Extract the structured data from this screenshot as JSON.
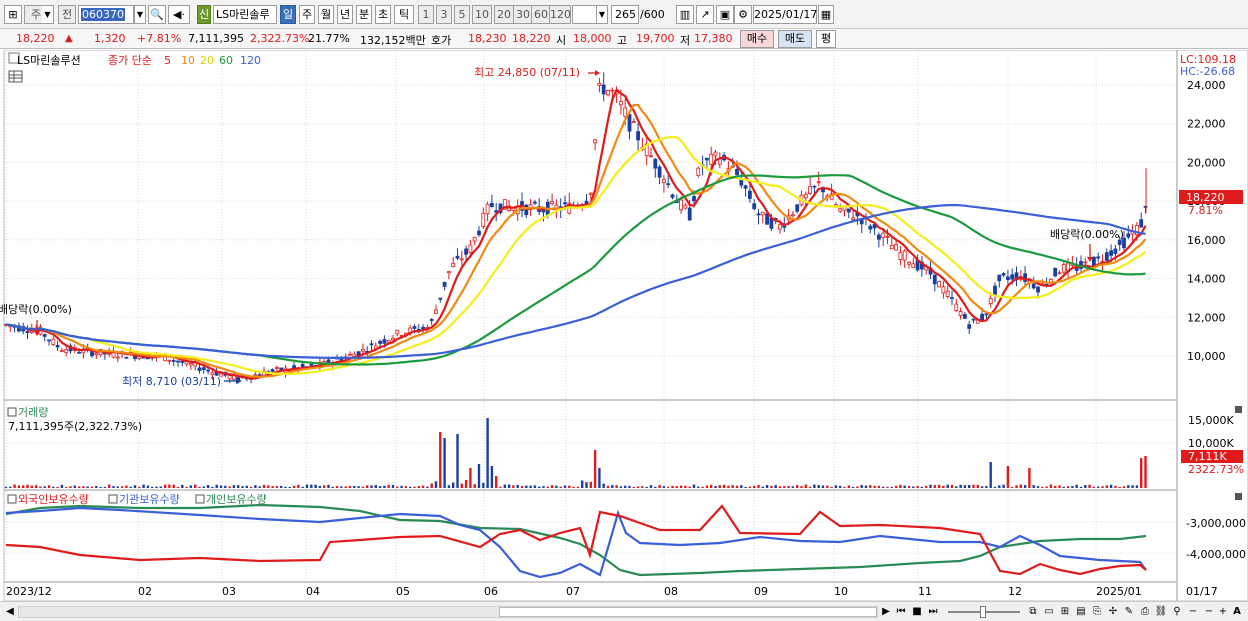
{
  "toolbar": {
    "period_buttons": [
      "주",
      "전"
    ],
    "stock_code": "060370",
    "stock_name": "LS마린솔루",
    "badge": "신",
    "tabs": [
      "일",
      "주",
      "월",
      "년",
      "분",
      "초",
      "틱"
    ],
    "intervals": [
      "1",
      "3",
      "5",
      "10",
      "20",
      "30",
      "60",
      "120"
    ],
    "count": "265",
    "count_total": "/600",
    "date": "2025/01/17"
  },
  "quote": {
    "price": "18,220",
    "arrow": "▲",
    "change": "1,320",
    "change_pct": "+7.81%",
    "volume": "7,111,395",
    "volume_pct": "2,322.73%",
    "turnover": "21.77%",
    "amount": "132,152백만",
    "bid_label": "호가",
    "bid": "18,230",
    "ask": "18,220",
    "open_label": "시",
    "open": "18,000",
    "high_label": "고",
    "high": "19,700",
    "low_label": "저",
    "low": "17,380",
    "buy_label": "매수",
    "sell_label": "매도",
    "eval_label": "평"
  },
  "price_panel": {
    "legend_name": "LS마린솔루션",
    "legend_ma": "종가 단순",
    "ma_periods": [
      "5",
      "10",
      "20",
      "60",
      "120"
    ],
    "ma_colors": [
      "#e01b1b",
      "#f28a12",
      "#f2f020",
      "#1c9a3c",
      "#3a5fd8"
    ],
    "lc": "LC:109.18",
    "hc": "HC:-26.68",
    "y_ticks": [
      "24,000",
      "22,000",
      "20,000",
      "18,000",
      "16,000",
      "14,000",
      "12,000",
      "10,000"
    ],
    "current_price_tag": "18,220",
    "current_pct_tag": "7.81%",
    "high_annotation": "최고 24,850 (07/11)",
    "low_annotation": "최저 8,710 (03/11)",
    "dividend_left": "배당락(0.00%)",
    "dividend_right": "배당락(0.00%)"
  },
  "volume_panel": {
    "title": "거래량",
    "value": "7,111,395주(2,322.73%)",
    "y_ticks": [
      "15,000K",
      "10,000K"
    ],
    "tag_value": "7,111K",
    "tag_pct": "2322.73%"
  },
  "holding_panel": {
    "legends": [
      "외국인보유수량",
      "기관보유수량",
      "개인보유수량"
    ],
    "legend_colors": [
      "#e01b1b",
      "#3a5fd8",
      "#2a8a55"
    ],
    "y_ticks": [
      "-3,000,000",
      "-4,000,000"
    ]
  },
  "x_axis": {
    "labels": [
      "2023/12",
      "02",
      "03",
      "04",
      "05",
      "06",
      "07",
      "08",
      "09",
      "10",
      "11",
      "12",
      "2025/01"
    ],
    "right_label": "01/17"
  },
  "colors": {
    "up": "#e01b1b",
    "down": "#1a3f9e",
    "grid": "#d9d9d9"
  }
}
